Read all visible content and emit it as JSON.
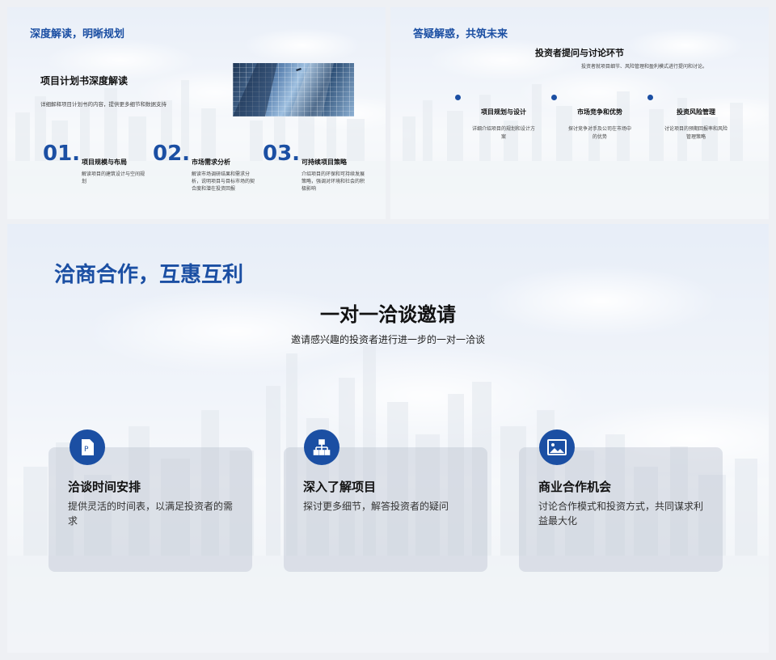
{
  "colors": {
    "accent": "#1b4fa3",
    "text": "#111111",
    "muted": "#444444"
  },
  "slide1": {
    "kicker": "深度解读，明晰规划",
    "title": "项目计划书深度解读",
    "subtitle": "详细解释项目计划书的内容，提供更多细节和数据支持",
    "items": [
      {
        "num": "01.",
        "title": "项目规模与布局",
        "desc": "解读项目的建筑设计与空间规划"
      },
      {
        "num": "02.",
        "title": "市场需求分析",
        "desc": "解读市场调研结果和需求分析，说明项目与目标市场的契合度和潜在投资回报"
      },
      {
        "num": "03.",
        "title": "可持续项目策略",
        "desc": "介绍项目的环保和可持续发展策略，强调对环境和社会的积极影响"
      }
    ]
  },
  "slide2": {
    "kicker": "答疑解惑，共筑未来",
    "title": "投资者提问与讨论环节",
    "subtitle": "投资者就项目细节、风险管理和盈利模式进行提问和讨论。",
    "columns": [
      {
        "title": "项目规划与设计",
        "desc": "详细介绍项目的规划和设计方案"
      },
      {
        "title": "市场竞争和优势",
        "desc": "探讨竞争对手及公司在市场中的优势"
      },
      {
        "title": "投资风险管理",
        "desc": "讨论项目的预期回报率和风险管理策略"
      }
    ]
  },
  "slide3": {
    "kicker": "洽商合作，互惠互利",
    "title": "一对一洽谈邀请",
    "subtitle": "邀请感兴趣的投资者进行进一步的一对一洽谈",
    "cards": [
      {
        "icon": "document-p-icon",
        "title": "洽谈时间安排",
        "desc": "提供灵活的时间表，以满足投资者的需求"
      },
      {
        "icon": "org-chart-icon",
        "title": "深入了解项目",
        "desc": "探讨更多细节，解答投资者的疑问"
      },
      {
        "icon": "image-icon",
        "title": "商业合作机会",
        "desc": "讨论合作模式和投资方式，共同谋求利益最大化"
      }
    ]
  }
}
